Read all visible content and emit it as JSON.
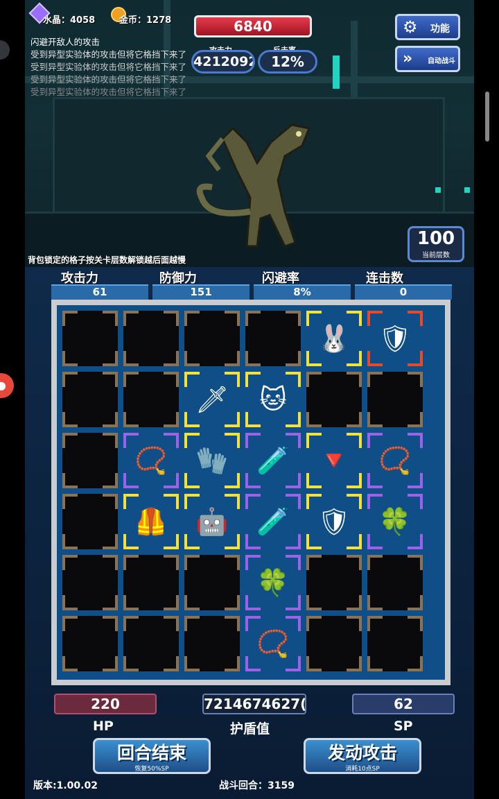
{
  "resources": {
    "crystal_label": "水晶：",
    "crystal": "4058",
    "gold_label": "金币：",
    "gold": "1278"
  },
  "enemy": {
    "hp": "6840"
  },
  "stats_top": {
    "attack_label": "攻击力",
    "attack": "4212092",
    "counter_label": "反击率",
    "counter": "12%"
  },
  "buttons": {
    "function": "功能",
    "auto_battle": "自动战斗"
  },
  "log": [
    "闪避开敌人的攻击",
    "受到异型实验体的攻击但将它格挡下来了",
    "受到异型实验体的攻击但将它格挡下来了",
    "受到异型实验体的攻击但将它格挡下来了",
    "受到异型实验体的攻击但将它格挡下来了"
  ],
  "floor": {
    "value": "100",
    "label": "当前层数"
  },
  "hint": "背包锁定的格子按关卡层数解锁越后面越慢",
  "stats": [
    {
      "label": "攻击力",
      "value": "61"
    },
    {
      "label": "防御力",
      "value": "151"
    },
    {
      "label": "闪避率",
      "value": "8%"
    },
    {
      "label": "连击数",
      "value": "0"
    }
  ],
  "inventory": [
    [
      "empty",
      "empty",
      "empty",
      "empty",
      "bunny-ears",
      "gold-armor"
    ],
    [
      "empty",
      "empty",
      "sword",
      "lucky-cat",
      "empty",
      "empty"
    ],
    [
      "empty",
      "necklace",
      "gauntlet",
      "potion-shield",
      "red-cape",
      "necklace"
    ],
    [
      "empty",
      "red-armor",
      "red-robot",
      "potion-shield",
      "golden-shield",
      "clover"
    ],
    [
      "empty",
      "empty",
      "empty",
      "clover",
      "empty",
      "empty"
    ],
    [
      "empty",
      "empty",
      "empty",
      "necklace",
      "empty",
      "empty"
    ]
  ],
  "bottom": {
    "hp": "220",
    "hp_label": "HP",
    "shield": "7214674627(",
    "shield_label": "护盾值",
    "sp": "62",
    "sp_label": "SP"
  },
  "actions": {
    "end_turn": "回合结束",
    "end_turn_sub": "恢复50%SP",
    "attack": "发动攻击",
    "attack_sub": "消耗10点SP"
  },
  "footer": {
    "version": "版本:1.00.02",
    "round": "战斗回合：3159"
  },
  "colors": {
    "rare_yellow": "#f4e23a",
    "rare_purple": "#9c63e8",
    "rare_red": "#e64a2a",
    "hp_red": "#d7263d"
  }
}
